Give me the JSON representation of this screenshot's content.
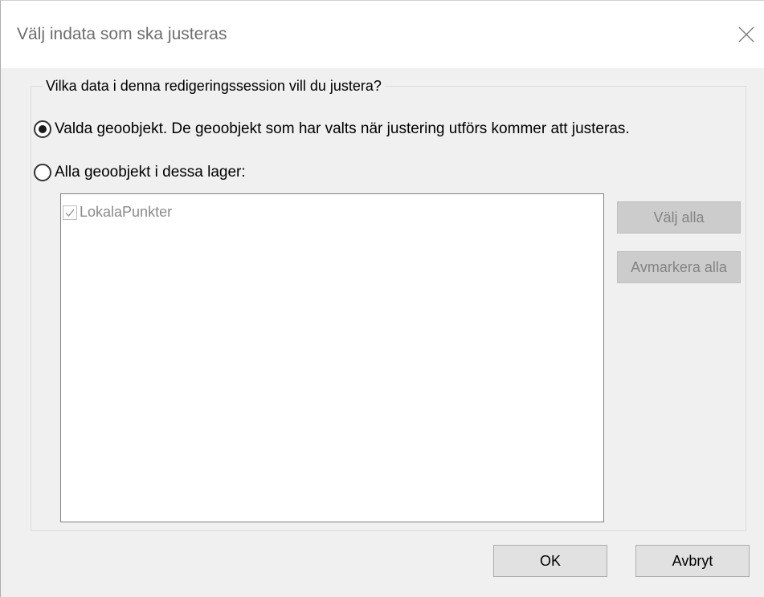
{
  "window": {
    "title": "Välj indata som ska justeras"
  },
  "group": {
    "legend": "Vilka data i denna redigeringssession vill du justera?"
  },
  "options": [
    {
      "label": "Valda geoobjekt. De geoobjekt som har valts när justering utförs kommer att justeras.",
      "checked": true
    },
    {
      "label": "Alla geoobjekt i dessa lager:",
      "checked": false
    }
  ],
  "layers": [
    {
      "label": "LokalaPunkter",
      "checked": true,
      "enabled": false
    }
  ],
  "buttons": {
    "select_all": "Välj alla",
    "deselect_all": "Avmarkera alla",
    "ok": "OK",
    "cancel": "Avbryt"
  },
  "icons": {
    "close": "close-icon",
    "check": "checkmark-icon"
  }
}
